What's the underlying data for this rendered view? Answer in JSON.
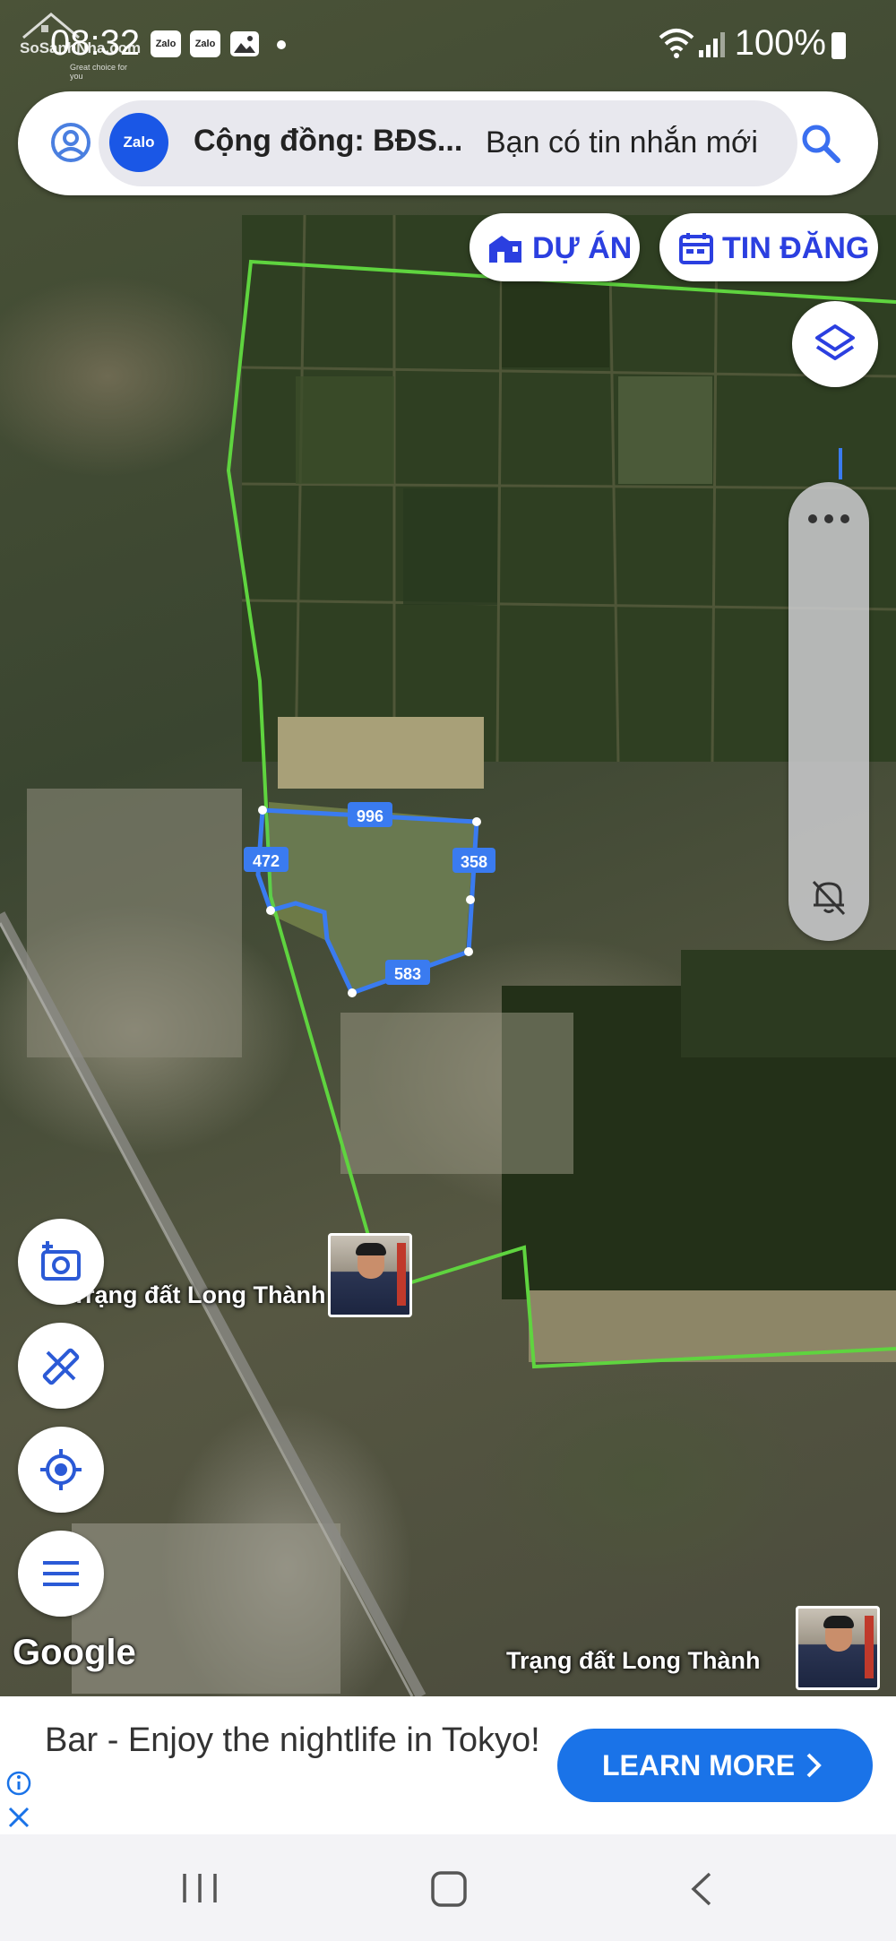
{
  "status_bar": {
    "time": "08:32",
    "watermark_name": "SoSanhNha.com",
    "watermark_tagline": "Great choice for you",
    "notification_icons": [
      "Zalo",
      "Zalo"
    ],
    "battery": "100%"
  },
  "search": {
    "notification_title": "Cộng đồng: BĐS...",
    "notification_message": "Bạn có tin nhắn mới",
    "app_badge": "Zalo"
  },
  "buttons": {
    "project_label": "DỰ ÁN",
    "listing_label": "TIN ĐĂNG"
  },
  "map": {
    "parcel_edges": [
      "996",
      "358",
      "583",
      "472"
    ],
    "marker_label": "Trạng đất Long Thành",
    "corner_label": "Trạng đất Long Thành",
    "attribution": "Google",
    "colors": {
      "boundary": "#5fd43f",
      "parcel": "#3a7bf0"
    }
  },
  "ad": {
    "text": "Bar - Enjoy the nightlife in Tokyo!",
    "cta_label": "LEARN MORE"
  },
  "icons": [
    "profile-icon",
    "search-icon",
    "building-icon",
    "calendar-icon",
    "layers-icon",
    "more-icon",
    "bell-off-icon",
    "camera-add-icon",
    "measure-icon",
    "my-location-icon",
    "menu-icon",
    "info-icon",
    "close-icon"
  ]
}
